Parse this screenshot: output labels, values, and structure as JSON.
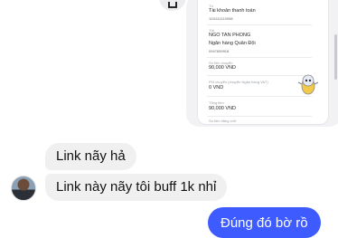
{
  "shared_image": {
    "rows": [
      {
        "label": "Từ",
        "value": "Tài khoản thanh toán",
        "sub": "1111111110058"
      },
      {
        "label": "Tới",
        "value": "NGO TAN PHONG",
        "sub": "Ngân hàng Quân Đội",
        "sub2": "0947659918"
      },
      {
        "label": "Số tiền chuyển",
        "value": "90,000 VND"
      },
      {
        "label": "Phí chuyển (chuyển Ngân hàng VAT)",
        "value": "0 VND"
      },
      {
        "label": "Tổng tiền",
        "value": "90,000 VND"
      },
      {
        "label": "Số tiền bằng chữ",
        "value": ""
      }
    ]
  },
  "messages": {
    "received_1": "Link nãy hả",
    "received_2": "Link này nãy tôi buff 1k nhỉ",
    "sent_1": "Đúng đó bờ rồ"
  },
  "colors": {
    "sent_bubble": "#3d5bff",
    "received_bubble": "#f0f0f0"
  },
  "icons": {
    "share": "share-icon",
    "mascot": "mascot-icon"
  }
}
